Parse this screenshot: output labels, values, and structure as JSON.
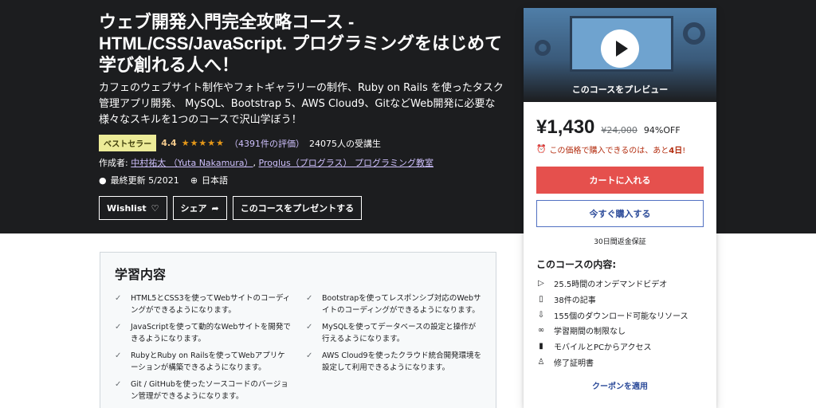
{
  "header": {
    "title": "ウェブ開発入門完全攻略コース - HTML/CSS/JavaScript. プログラミングをはじめて学び創れる人へ！",
    "subtitle": "カフェのウェブサイト制作やフォトギャラリーの制作、Ruby on Rails を使ったタスク管理アプリ開発、 MySQL、Bootstrap 5、AWS Cloud9、GitなどWeb開発に必要な様々なスキルを1つのコースで沢山学ぼう！",
    "badge": "ベストセラー",
    "rating": "4.4",
    "stars": "★★★★★",
    "rating_count": "（4391件の評価）",
    "students": "24075人の受講生",
    "author_label": "作成者:",
    "author1": "中村祐太 （Yuta Nakamura）",
    "author_sep": ",",
    "author2": "Proglus（プログラス） プログラミング教室",
    "updated": "最終更新 5/2021",
    "language": "日本語",
    "wishlist_label": "Wishlist",
    "share_label": "シェア",
    "gift_label": "このコースをプレゼントする"
  },
  "sidebar": {
    "preview_label": "このコースをプレビュー",
    "price": "¥1,430",
    "original_price": "¥24,000",
    "discount": "94%OFF",
    "urgency_prefix": "この価格で購入できるのは、あと",
    "urgency_days": "4日",
    "urgency_suffix": "!",
    "cart_button": "カートに入れる",
    "buy_button": "今すぐ購入する",
    "guarantee": "30日間返金保証",
    "includes_title": "このコースの内容:",
    "includes": [
      {
        "icon": "video-icon",
        "glyph": "▷",
        "label": "25.5時間のオンデマンドビデオ"
      },
      {
        "icon": "article-icon",
        "glyph": "▯",
        "label": "38件の記事"
      },
      {
        "icon": "download-icon",
        "glyph": "⇩",
        "label": "155個のダウンロード可能なリソース"
      },
      {
        "icon": "infinity-icon",
        "glyph": "∞",
        "label": "学習期間の制限なし"
      },
      {
        "icon": "mobile-icon",
        "glyph": "▮",
        "label": "モバイルとPCからアクセス"
      },
      {
        "icon": "certificate-icon",
        "glyph": "♙",
        "label": "修了証明書"
      }
    ],
    "coupon": "クーポンを適用"
  },
  "learn": {
    "title": "学習内容",
    "check_glyph": "✓",
    "items": [
      "HTML5とCSS3を使ってWebサイトのコーディングができるようになります。",
      "Bootstrapを使ってレスポンシブ対応のWebサイトのコーディングができるようになります。",
      "JavaScriptを使って動的なWebサイトを開発できるようになります。",
      "MySQLを使ってデータベースの設定と操作が行えるようになります。",
      "RubyとRuby on Railsを使ってWebアプリケーションが構築できるようになります。",
      "AWS Cloud9を使ったクラウド統合開発環境を設定して利用できるようになります。",
      "Git / GitHubを使ったソースコードのバージョン管理ができるようになります。"
    ]
  },
  "colors": {
    "hero_bg": "#1c1d1f",
    "cart_red": "#e5504d",
    "link_purple": "#cec0fc",
    "buy_blue": "#2b4a99"
  }
}
